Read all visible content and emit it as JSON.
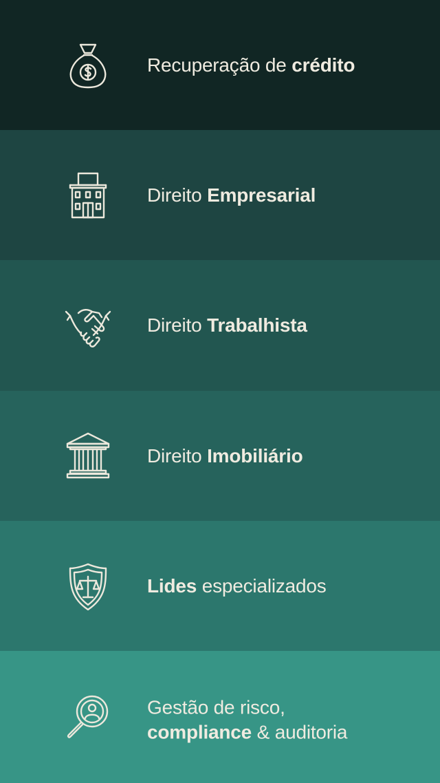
{
  "colors": {
    "text": "#efebe0",
    "icon_stroke": "#ece8dc",
    "band_1": "#112624",
    "band_2": "#1e4542",
    "band_3": "#225650",
    "band_4": "#26635c",
    "band_5": "#2c776d",
    "band_6": "#379586"
  },
  "services": [
    {
      "icon": "money-bag-icon",
      "text_regular": "Recuperação de ",
      "text_bold": "crédito"
    },
    {
      "icon": "office-building-icon",
      "text_regular": "Direito ",
      "text_bold": "Empresarial"
    },
    {
      "icon": "handshake-icon",
      "text_regular": "Direito ",
      "text_bold": "Trabalhista"
    },
    {
      "icon": "columned-building-icon",
      "text_regular": "Direito ",
      "text_bold": "Imobiliário"
    },
    {
      "icon": "shield-scales-icon",
      "text_bold": "Lides",
      "text_regular": " especializados"
    },
    {
      "icon": "magnifier-person-icon",
      "line1": "Gestão de risco,",
      "line2_bold": "compliance",
      "line2_regular": " & auditoria"
    }
  ]
}
